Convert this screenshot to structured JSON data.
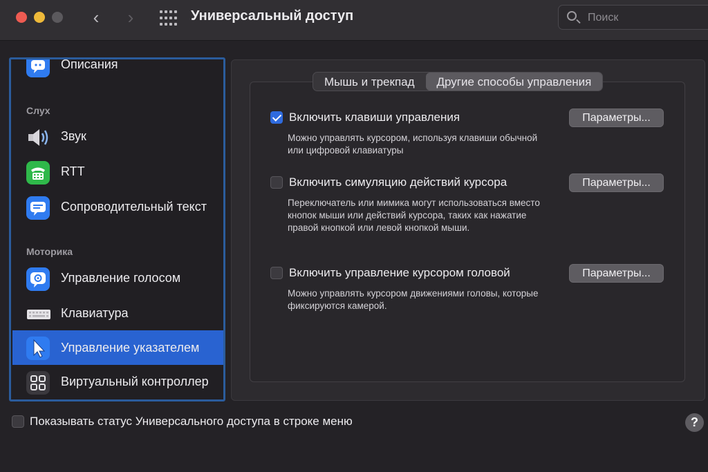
{
  "window": {
    "title": "Универсальный доступ",
    "search_placeholder": "Поиск"
  },
  "sidebar": {
    "sections": [
      {
        "label": "Слух"
      },
      {
        "label": "Моторика"
      }
    ],
    "items": [
      {
        "label": "Описания",
        "icon": "speech-bubble-icon"
      },
      {
        "label": "Звук",
        "icon": "speaker-icon"
      },
      {
        "label": "RTT",
        "icon": "tty-phone-icon"
      },
      {
        "label": "Сопроводительный текст",
        "icon": "captions-icon"
      },
      {
        "label": "Управление голосом",
        "icon": "voice-control-icon"
      },
      {
        "label": "Клавиатура",
        "icon": "keyboard-icon"
      },
      {
        "label": "Управление указателем",
        "icon": "pointer-icon",
        "selected": true
      },
      {
        "label": "Виртуальный контроллер",
        "icon": "switch-control-icon"
      }
    ]
  },
  "tabs": [
    {
      "label": "Мышь и трекпад",
      "active": false
    },
    {
      "label": "Другие способы управления",
      "active": true
    }
  ],
  "options": [
    {
      "label": "Включить клавиши управления",
      "checked": true,
      "description": "Можно управлять курсором, используя клавиши обычной или цифровой клавиатуры",
      "button": "Параметры..."
    },
    {
      "label": "Включить симуляцию действий курсора",
      "checked": false,
      "description": "Переключатель или мимика могут использоваться вместо кнопок мыши или действий курсора, таких как нажатие правой кнопкой или левой кнопкой мыши.",
      "button": "Параметры..."
    },
    {
      "label": "Включить управление курсором головой",
      "checked": false,
      "description": "Можно управлять курсором движениями головы, которые фиксируются камерой.",
      "button": "Параметры..."
    }
  ],
  "footer": {
    "status_label": "Показывать статус Универсального доступа в строке меню",
    "status_checked": false,
    "help": "?"
  },
  "colors": {
    "accent": "#2963d1",
    "sidebar_border": "#2b5c9c"
  }
}
